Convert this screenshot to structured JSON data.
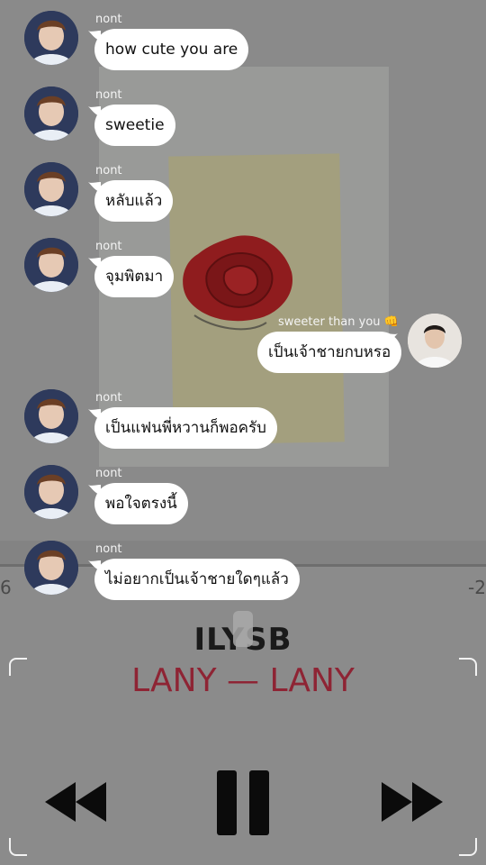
{
  "player": {
    "time_elapsed": "6",
    "time_remaining": "-2",
    "song_title": "ILYSB",
    "artist_album": "LANY — LANY"
  },
  "messages": [
    {
      "sender": "nont",
      "text": "how cute you are"
    },
    {
      "sender": "nont",
      "text": "sweetie"
    },
    {
      "sender": "nont",
      "text": "หลับแล้ว"
    },
    {
      "sender": "nont",
      "text": "จุมพิตมา"
    },
    {
      "sender": "sweeter than you 👊",
      "text": "เป็นเจ้าชายกบหรอ"
    },
    {
      "sender": "nont",
      "text": "เป็นแฟนพี่หวานก็พอครับ"
    },
    {
      "sender": "nont",
      "text": "พอใจตรงนี้"
    },
    {
      "sender": "nont",
      "text": "ไม่อยากเป็นเจ้าชายใดๆแล้ว"
    }
  ],
  "icons": {
    "rewind": "rewind-icon",
    "pause": "pause-icon",
    "forward": "fast-forward-icon"
  },
  "colors": {
    "bubble": "#ffffff",
    "artist": "#8e2434"
  }
}
